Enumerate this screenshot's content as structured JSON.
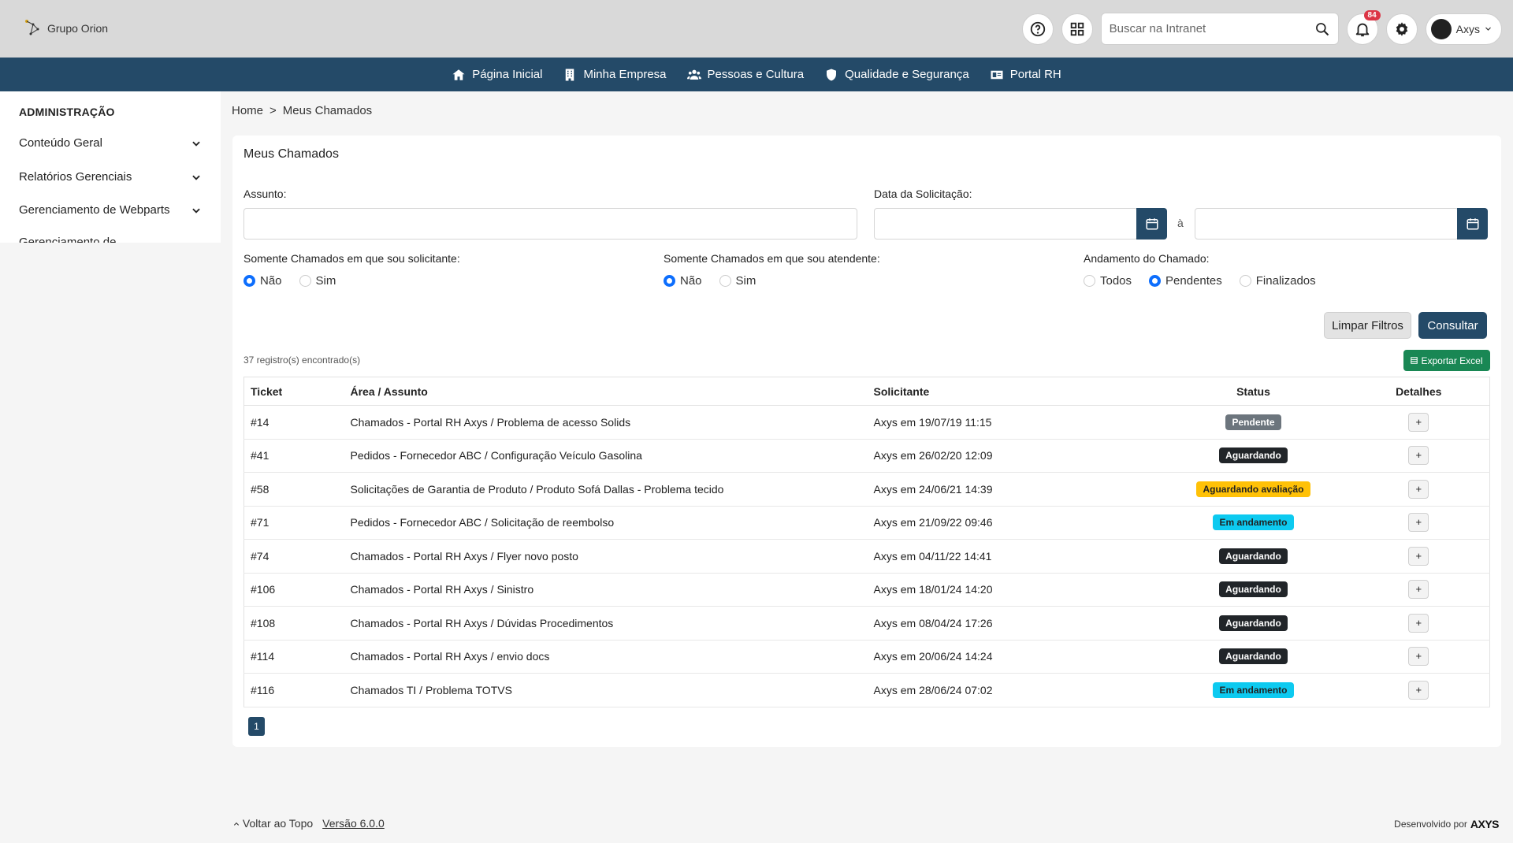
{
  "header": {
    "logo_text": "Grupo Orion",
    "search_placeholder": "Buscar na Intranet",
    "notification_count": "84",
    "user_name": "Axys"
  },
  "nav": {
    "items": [
      {
        "label": "Página Inicial",
        "icon": "home-icon"
      },
      {
        "label": "Minha Empresa",
        "icon": "building-icon"
      },
      {
        "label": "Pessoas e Cultura",
        "icon": "people-icon"
      },
      {
        "label": "Qualidade e Segurança",
        "icon": "shield-icon"
      },
      {
        "label": "Portal RH",
        "icon": "id-card-icon"
      }
    ]
  },
  "sidebar": {
    "title": "ADMINISTRAÇÃO",
    "items": [
      {
        "label": "Conteúdo Geral"
      },
      {
        "label": "Relatórios Gerenciais"
      },
      {
        "label": "Gerenciamento de Webparts"
      },
      {
        "label": "Gerenciamento de"
      }
    ]
  },
  "breadcrumb": {
    "home": "Home",
    "separator": ">",
    "current": "Meus Chamados"
  },
  "page": {
    "title": "Meus Chamados",
    "filters": {
      "assunto_label": "Assunto:",
      "data_label": "Data da Solicitação:",
      "date_separator": "à",
      "solicitante_label": "Somente Chamados em que sou solicitante:",
      "solicitante_options": [
        "Não",
        "Sim"
      ],
      "atendente_label": "Somente Chamados em que sou atendente:",
      "atendente_options": [
        "Não",
        "Sim"
      ],
      "andamento_label": "Andamento do Chamado:",
      "andamento_options": [
        "Todos",
        "Pendentes",
        "Finalizados"
      ]
    },
    "clear_button": "Limpar Filtros",
    "query_button": "Consultar",
    "records_text": "37 registro(s) encontrado(s)",
    "export_button": "Exportar Excel"
  },
  "table": {
    "headers": [
      "Ticket",
      "Área / Assunto",
      "Solicitante",
      "Status",
      "Detalhes"
    ],
    "rows": [
      {
        "ticket": "#14",
        "area": "Chamados - Portal RH Axys / Problema de acesso Solids",
        "solicitante": "Axys em 19/07/19 11:15",
        "status": "Pendente"
      },
      {
        "ticket": "#41",
        "area": "Pedidos - Fornecedor ABC / Configuração Veículo Gasolina",
        "solicitante": "Axys em 26/02/20 12:09",
        "status": "Aguardando"
      },
      {
        "ticket": "#58",
        "area": "Solicitações de Garantia de Produto / Produto Sofá Dallas - Problema tecido",
        "solicitante": "Axys em 24/06/21 14:39",
        "status": "Aguardando avaliação"
      },
      {
        "ticket": "#71",
        "area": "Pedidos - Fornecedor ABC / Solicitação de reembolso",
        "solicitante": "Axys em 21/09/22 09:46",
        "status": "Em andamento"
      },
      {
        "ticket": "#74",
        "area": "Chamados - Portal RH Axys / Flyer novo posto",
        "solicitante": "Axys em 04/11/22 14:41",
        "status": "Aguardando"
      },
      {
        "ticket": "#106",
        "area": "Chamados - Portal RH Axys / Sinistro",
        "solicitante": "Axys em 18/01/24 14:20",
        "status": "Aguardando"
      },
      {
        "ticket": "#108",
        "area": "Chamados - Portal RH Axys / Dúvidas Procedimentos",
        "solicitante": "Axys em 08/04/24 17:26",
        "status": "Aguardando"
      },
      {
        "ticket": "#114",
        "area": "Chamados - Portal RH Axys / envio docs",
        "solicitante": "Axys em 20/06/24 14:24",
        "status": "Aguardando"
      },
      {
        "ticket": "#116",
        "area": "Chamados TI / Problema TOTVS",
        "solicitante": "Axys em 28/06/24 07:02",
        "status": "Em andamento"
      }
    ],
    "details_symbol": "+"
  },
  "pagination": {
    "current_page": "1"
  },
  "footer": {
    "back_to_top": "Voltar ao Topo",
    "version": "Versão 6.0.0",
    "developed_by": "Desenvolvido por",
    "brand": "AXYS"
  },
  "colors": {
    "primary": "#244a68",
    "pending": "#6c757d",
    "waiting": "#212529",
    "evaluation": "#ffc107",
    "in_progress": "#0dcaf0",
    "excel": "#198754",
    "notification": "#dc3545"
  }
}
